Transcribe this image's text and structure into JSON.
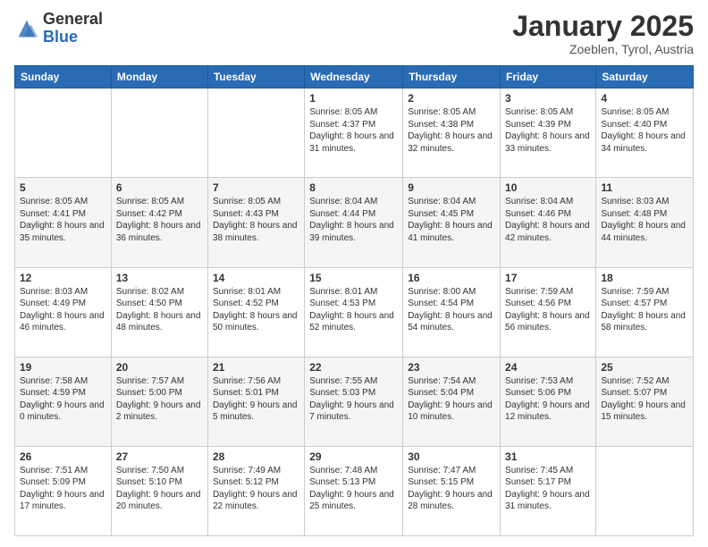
{
  "header": {
    "logo_general": "General",
    "logo_blue": "Blue",
    "month_title": "January 2025",
    "location": "Zoeblen, Tyrol, Austria"
  },
  "days_of_week": [
    "Sunday",
    "Monday",
    "Tuesday",
    "Wednesday",
    "Thursday",
    "Friday",
    "Saturday"
  ],
  "weeks": [
    [
      {
        "day": "",
        "info": ""
      },
      {
        "day": "",
        "info": ""
      },
      {
        "day": "",
        "info": ""
      },
      {
        "day": "1",
        "info": "Sunrise: 8:05 AM\nSunset: 4:37 PM\nDaylight: 8 hours and 31 minutes."
      },
      {
        "day": "2",
        "info": "Sunrise: 8:05 AM\nSunset: 4:38 PM\nDaylight: 8 hours and 32 minutes."
      },
      {
        "day": "3",
        "info": "Sunrise: 8:05 AM\nSunset: 4:39 PM\nDaylight: 8 hours and 33 minutes."
      },
      {
        "day": "4",
        "info": "Sunrise: 8:05 AM\nSunset: 4:40 PM\nDaylight: 8 hours and 34 minutes."
      }
    ],
    [
      {
        "day": "5",
        "info": "Sunrise: 8:05 AM\nSunset: 4:41 PM\nDaylight: 8 hours and 35 minutes."
      },
      {
        "day": "6",
        "info": "Sunrise: 8:05 AM\nSunset: 4:42 PM\nDaylight: 8 hours and 36 minutes."
      },
      {
        "day": "7",
        "info": "Sunrise: 8:05 AM\nSunset: 4:43 PM\nDaylight: 8 hours and 38 minutes."
      },
      {
        "day": "8",
        "info": "Sunrise: 8:04 AM\nSunset: 4:44 PM\nDaylight: 8 hours and 39 minutes."
      },
      {
        "day": "9",
        "info": "Sunrise: 8:04 AM\nSunset: 4:45 PM\nDaylight: 8 hours and 41 minutes."
      },
      {
        "day": "10",
        "info": "Sunrise: 8:04 AM\nSunset: 4:46 PM\nDaylight: 8 hours and 42 minutes."
      },
      {
        "day": "11",
        "info": "Sunrise: 8:03 AM\nSunset: 4:48 PM\nDaylight: 8 hours and 44 minutes."
      }
    ],
    [
      {
        "day": "12",
        "info": "Sunrise: 8:03 AM\nSunset: 4:49 PM\nDaylight: 8 hours and 46 minutes."
      },
      {
        "day": "13",
        "info": "Sunrise: 8:02 AM\nSunset: 4:50 PM\nDaylight: 8 hours and 48 minutes."
      },
      {
        "day": "14",
        "info": "Sunrise: 8:01 AM\nSunset: 4:52 PM\nDaylight: 8 hours and 50 minutes."
      },
      {
        "day": "15",
        "info": "Sunrise: 8:01 AM\nSunset: 4:53 PM\nDaylight: 8 hours and 52 minutes."
      },
      {
        "day": "16",
        "info": "Sunrise: 8:00 AM\nSunset: 4:54 PM\nDaylight: 8 hours and 54 minutes."
      },
      {
        "day": "17",
        "info": "Sunrise: 7:59 AM\nSunset: 4:56 PM\nDaylight: 8 hours and 56 minutes."
      },
      {
        "day": "18",
        "info": "Sunrise: 7:59 AM\nSunset: 4:57 PM\nDaylight: 8 hours and 58 minutes."
      }
    ],
    [
      {
        "day": "19",
        "info": "Sunrise: 7:58 AM\nSunset: 4:59 PM\nDaylight: 9 hours and 0 minutes."
      },
      {
        "day": "20",
        "info": "Sunrise: 7:57 AM\nSunset: 5:00 PM\nDaylight: 9 hours and 2 minutes."
      },
      {
        "day": "21",
        "info": "Sunrise: 7:56 AM\nSunset: 5:01 PM\nDaylight: 9 hours and 5 minutes."
      },
      {
        "day": "22",
        "info": "Sunrise: 7:55 AM\nSunset: 5:03 PM\nDaylight: 9 hours and 7 minutes."
      },
      {
        "day": "23",
        "info": "Sunrise: 7:54 AM\nSunset: 5:04 PM\nDaylight: 9 hours and 10 minutes."
      },
      {
        "day": "24",
        "info": "Sunrise: 7:53 AM\nSunset: 5:06 PM\nDaylight: 9 hours and 12 minutes."
      },
      {
        "day": "25",
        "info": "Sunrise: 7:52 AM\nSunset: 5:07 PM\nDaylight: 9 hours and 15 minutes."
      }
    ],
    [
      {
        "day": "26",
        "info": "Sunrise: 7:51 AM\nSunset: 5:09 PM\nDaylight: 9 hours and 17 minutes."
      },
      {
        "day": "27",
        "info": "Sunrise: 7:50 AM\nSunset: 5:10 PM\nDaylight: 9 hours and 20 minutes."
      },
      {
        "day": "28",
        "info": "Sunrise: 7:49 AM\nSunset: 5:12 PM\nDaylight: 9 hours and 22 minutes."
      },
      {
        "day": "29",
        "info": "Sunrise: 7:48 AM\nSunset: 5:13 PM\nDaylight: 9 hours and 25 minutes."
      },
      {
        "day": "30",
        "info": "Sunrise: 7:47 AM\nSunset: 5:15 PM\nDaylight: 9 hours and 28 minutes."
      },
      {
        "day": "31",
        "info": "Sunrise: 7:45 AM\nSunset: 5:17 PM\nDaylight: 9 hours and 31 minutes."
      },
      {
        "day": "",
        "info": ""
      }
    ]
  ]
}
